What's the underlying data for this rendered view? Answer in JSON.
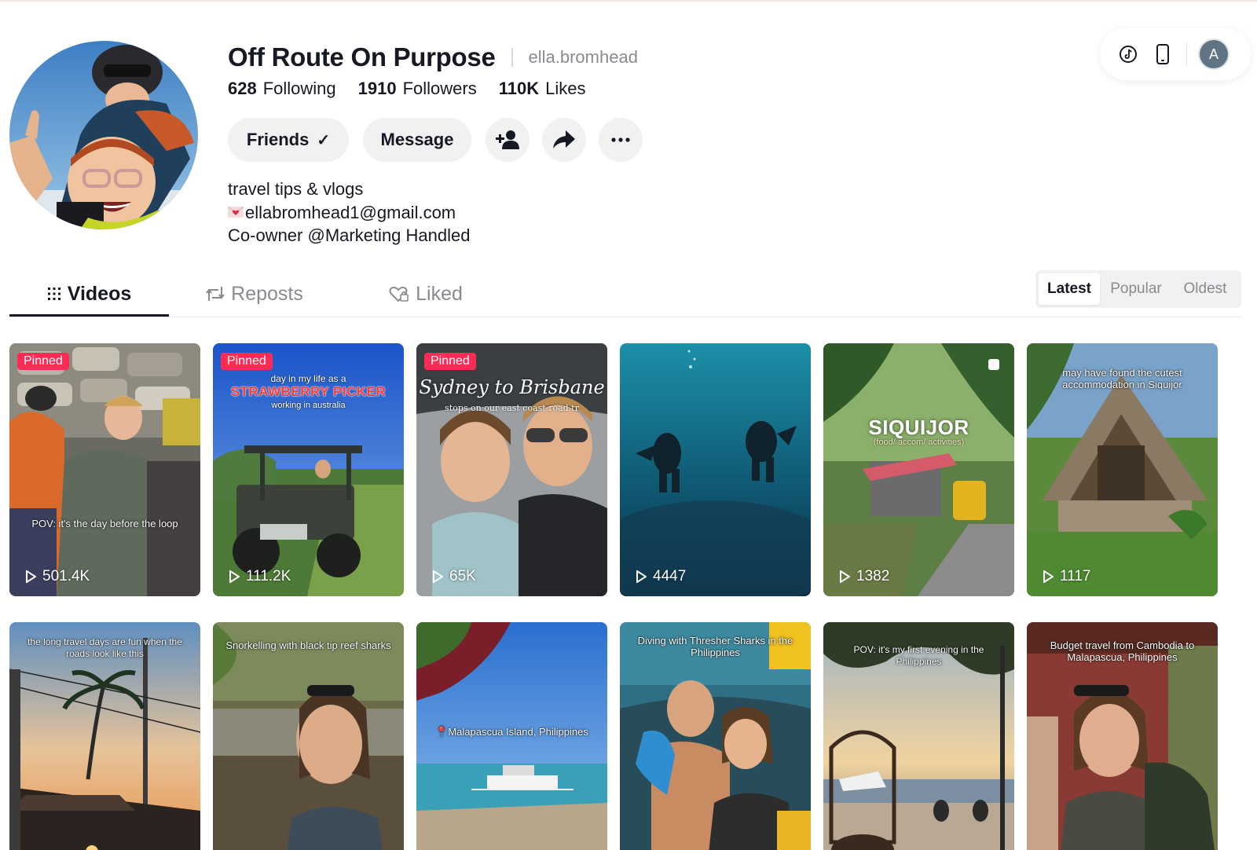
{
  "profile": {
    "display_name": "Off Route On Purpose",
    "handle": "ella.bromhead",
    "stats": {
      "following_count": "628",
      "following_label": "Following",
      "followers_count": "1910",
      "followers_label": "Followers",
      "likes_count": "110K",
      "likes_label": "Likes"
    },
    "actions": {
      "friends_label": "Friends",
      "friends_check": "✓",
      "message_label": "Message"
    },
    "bio": {
      "line1": "travel tips & vlogs",
      "line2": "ellabromhead1@gmail.com",
      "line3": "Co-owner @Marketing Handled"
    }
  },
  "top_widget": {
    "avatar_letter": "A",
    "icons": [
      "tiktok-icon",
      "phone-icon"
    ]
  },
  "tabs": [
    {
      "label": "Videos",
      "icon": "grid-icon",
      "active": true
    },
    {
      "label": "Reposts",
      "icon": "repost-icon",
      "active": false
    },
    {
      "label": "Liked",
      "icon": "heart-icon",
      "active": false
    }
  ],
  "sort": {
    "options": [
      "Latest",
      "Popular",
      "Oldest"
    ],
    "selected": "Latest"
  },
  "videos": [
    {
      "pinned": true,
      "pinned_label": "Pinned",
      "caption": "POV: it's the day before the loop",
      "views": "501.4K"
    },
    {
      "pinned": true,
      "pinned_label": "Pinned",
      "caption_top": "day in my life as a",
      "title": "STRAWBERRY PICKER",
      "caption_sub": "working in australia",
      "views": "111.2K"
    },
    {
      "pinned": true,
      "pinned_label": "Pinned",
      "title": "Sydney to Brisbane",
      "caption_sub": "stops on our east coast road tr",
      "views": "65K"
    },
    {
      "pinned": false,
      "views": "4447"
    },
    {
      "pinned": false,
      "title": "SIQUIJOR",
      "caption_sub": "(food/ accom/ activities)",
      "views": "1382"
    },
    {
      "pinned": false,
      "caption": "may have found the cutest accommodation in Siquijor",
      "views": "1117"
    },
    {
      "pinned": false,
      "caption": "the long travel days are fun when the roads look like this"
    },
    {
      "pinned": false,
      "caption": "Snorkelling with black tip reef sharks"
    },
    {
      "pinned": false,
      "caption": "Malapascua Island, Philippines"
    },
    {
      "pinned": false,
      "caption": "Diving with Thresher Sharks in the Philippines"
    },
    {
      "pinned": false,
      "caption": "POV: it's my first evening in the Philippines"
    },
    {
      "pinned": false,
      "caption": "Budget travel from Cambodia to Malapascua, Philippines"
    }
  ],
  "colors": {
    "accent": "#fe2c55",
    "text": "#161823",
    "muted": "#8a8b91",
    "button_bg": "#f1f1f2"
  }
}
